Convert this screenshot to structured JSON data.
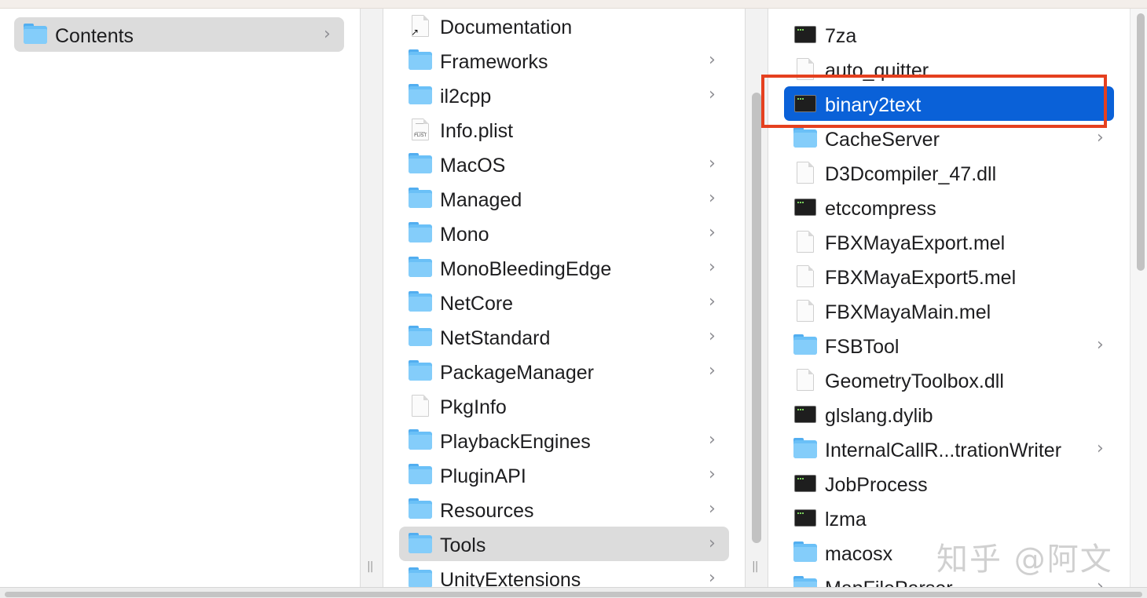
{
  "column1": {
    "items": [
      {
        "label": "Contents",
        "icon": "folder-icon",
        "has_children": true,
        "selected": true
      }
    ]
  },
  "column2": {
    "items": [
      {
        "label": "Documentation",
        "icon": "alias-document-icon",
        "has_children": false
      },
      {
        "label": "Frameworks",
        "icon": "folder-icon",
        "has_children": true
      },
      {
        "label": "il2cpp",
        "icon": "folder-icon",
        "has_children": true
      },
      {
        "label": "Info.plist",
        "icon": "plist-icon",
        "has_children": false
      },
      {
        "label": "MacOS",
        "icon": "folder-icon",
        "has_children": true
      },
      {
        "label": "Managed",
        "icon": "folder-icon",
        "has_children": true
      },
      {
        "label": "Mono",
        "icon": "folder-icon",
        "has_children": true
      },
      {
        "label": "MonoBleedingEdge",
        "icon": "folder-icon",
        "has_children": true
      },
      {
        "label": "NetCore",
        "icon": "folder-icon",
        "has_children": true
      },
      {
        "label": "NetStandard",
        "icon": "folder-icon",
        "has_children": true
      },
      {
        "label": "PackageManager",
        "icon": "folder-icon",
        "has_children": true
      },
      {
        "label": "PkgInfo",
        "icon": "document-icon",
        "has_children": false
      },
      {
        "label": "PlaybackEngines",
        "icon": "folder-icon",
        "has_children": true
      },
      {
        "label": "PluginAPI",
        "icon": "folder-icon",
        "has_children": true
      },
      {
        "label": "Resources",
        "icon": "folder-icon",
        "has_children": true
      },
      {
        "label": "Tools",
        "icon": "folder-icon",
        "has_children": true,
        "selected": true
      },
      {
        "label": "UnityExtensions",
        "icon": "folder-icon",
        "has_children": true
      }
    ]
  },
  "column3": {
    "items": [
      {
        "label": "7za",
        "icon": "executable-icon",
        "has_children": false
      },
      {
        "label": "auto_quitter",
        "icon": "document-icon",
        "has_children": false
      },
      {
        "label": "binary2text",
        "icon": "executable-icon",
        "has_children": false,
        "selected": true
      },
      {
        "label": "CacheServer",
        "icon": "folder-icon",
        "has_children": true
      },
      {
        "label": "D3Dcompiler_47.dll",
        "icon": "document-icon",
        "has_children": false
      },
      {
        "label": "etccompress",
        "icon": "executable-icon",
        "has_children": false
      },
      {
        "label": "FBXMayaExport.mel",
        "icon": "document-icon",
        "has_children": false
      },
      {
        "label": "FBXMayaExport5.mel",
        "icon": "document-icon",
        "has_children": false
      },
      {
        "label": "FBXMayaMain.mel",
        "icon": "document-icon",
        "has_children": false
      },
      {
        "label": "FSBTool",
        "icon": "folder-icon",
        "has_children": true
      },
      {
        "label": "GeometryToolbox.dll",
        "icon": "document-icon",
        "has_children": false
      },
      {
        "label": "glslang.dylib",
        "icon": "executable-icon",
        "has_children": false
      },
      {
        "label": "InternalCallR...trationWriter",
        "icon": "folder-icon",
        "has_children": true
      },
      {
        "label": "JobProcess",
        "icon": "executable-icon",
        "has_children": false
      },
      {
        "label": "lzma",
        "icon": "executable-icon",
        "has_children": false
      },
      {
        "label": "macosx",
        "icon": "folder-icon",
        "has_children": false
      },
      {
        "label": "MapFileParser",
        "icon": "folder-icon",
        "has_children": true
      }
    ]
  },
  "chevron_glyph": "›",
  "watermark": "知乎 @阿文",
  "colors": {
    "selection_active": "#0a61d8",
    "selection_inactive": "#dcdcdc",
    "annotation_box": "#e5401f",
    "folder": "#6ac0f7"
  }
}
